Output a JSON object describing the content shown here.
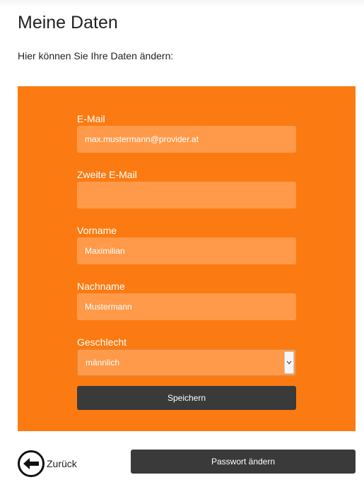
{
  "page": {
    "title": "Meine Daten",
    "subtitle": "Hier können Sie Ihre Daten ändern:"
  },
  "form": {
    "fields": [
      {
        "label": "E-Mail",
        "value": "max.mustermann@provider.at"
      },
      {
        "label": "Zweite E-Mail",
        "value": ""
      },
      {
        "label": "Vorname",
        "value": "Maximilian"
      },
      {
        "label": "Nachname",
        "value": "Mustermann"
      }
    ],
    "gender": {
      "label": "Geschlecht",
      "selected": "männlich"
    },
    "save_label": "Speichern"
  },
  "footer": {
    "back_label": "Zurück",
    "change_password_label": "Passwort ändern"
  },
  "colors": {
    "panel": "#fb7b12",
    "input": "#ff9a4a",
    "button": "#3a3a3a"
  },
  "icons": {
    "back": "arrow-left-circle-icon",
    "select": "chevron-down-icon"
  }
}
